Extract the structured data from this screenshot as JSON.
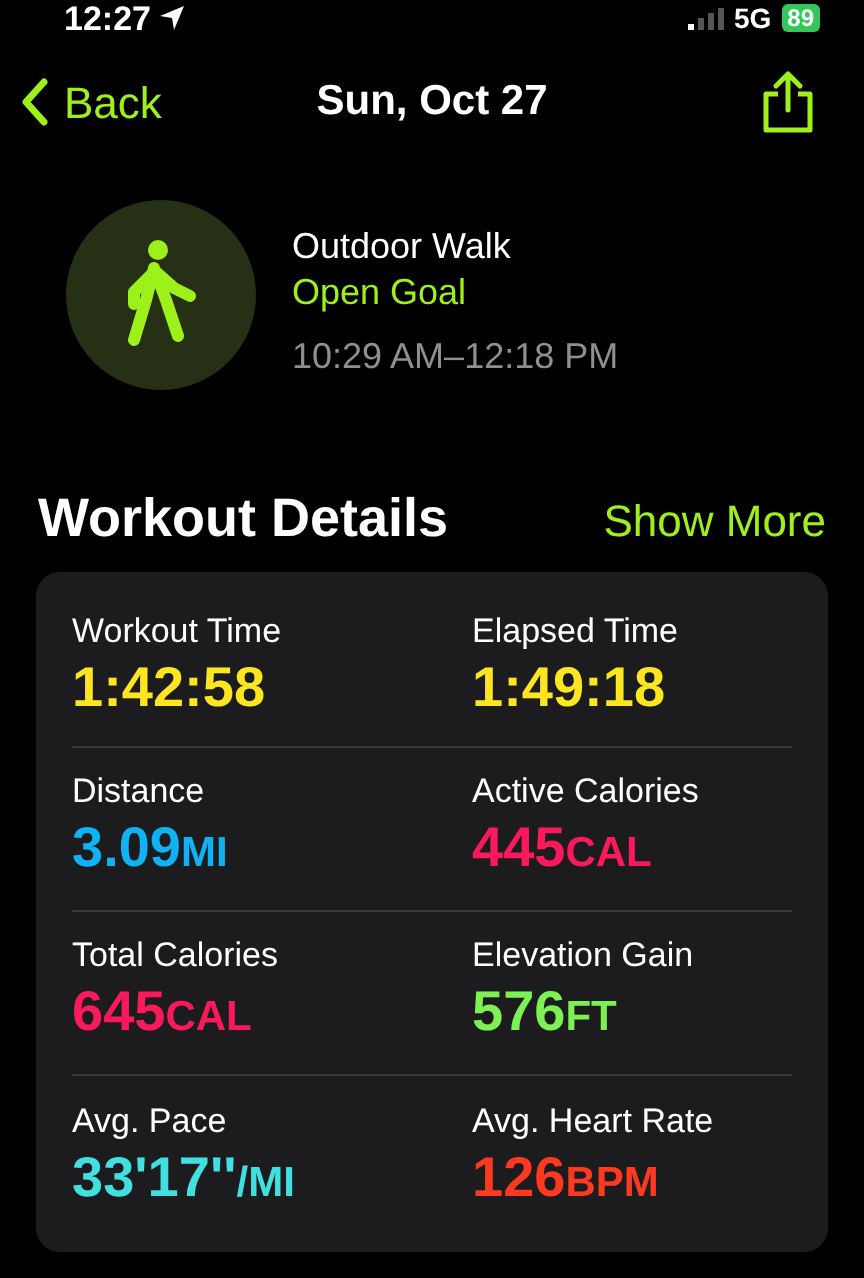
{
  "status_bar": {
    "time": "12:27",
    "network": "5G",
    "battery": "89"
  },
  "nav": {
    "back": "Back",
    "title": "Sun, Oct 27"
  },
  "workout": {
    "name": "Outdoor Walk",
    "goal": "Open Goal",
    "time_range": "10:29 AM–12:18 PM"
  },
  "section": {
    "title": "Workout Details",
    "action": "Show More"
  },
  "metrics": [
    {
      "label": "Workout Time",
      "value": "1:42:58",
      "color": "#fde620"
    },
    {
      "label": "Elapsed Time",
      "value": "1:49:18",
      "color": "#fde620"
    },
    {
      "label": "Distance",
      "value": "3.09",
      "unit": "MI",
      "color": "#0fb2f2"
    },
    {
      "label": "Active Calories",
      "value": "445",
      "unit": "CAL",
      "color": "#fa1a5b"
    },
    {
      "label": "Total Calories",
      "value": "645",
      "unit": "CAL",
      "color": "#fa1a5b"
    },
    {
      "label": "Elevation Gain",
      "value": "576",
      "unit": "FT",
      "color": "#7ef054"
    },
    {
      "label": "Avg. Pace",
      "value": "33'17''",
      "unit": "/MI",
      "color": "#40e0e0"
    },
    {
      "label": "Avg. Heart Rate",
      "value": "126",
      "unit": "BPM",
      "color": "#fd3a1f"
    }
  ]
}
